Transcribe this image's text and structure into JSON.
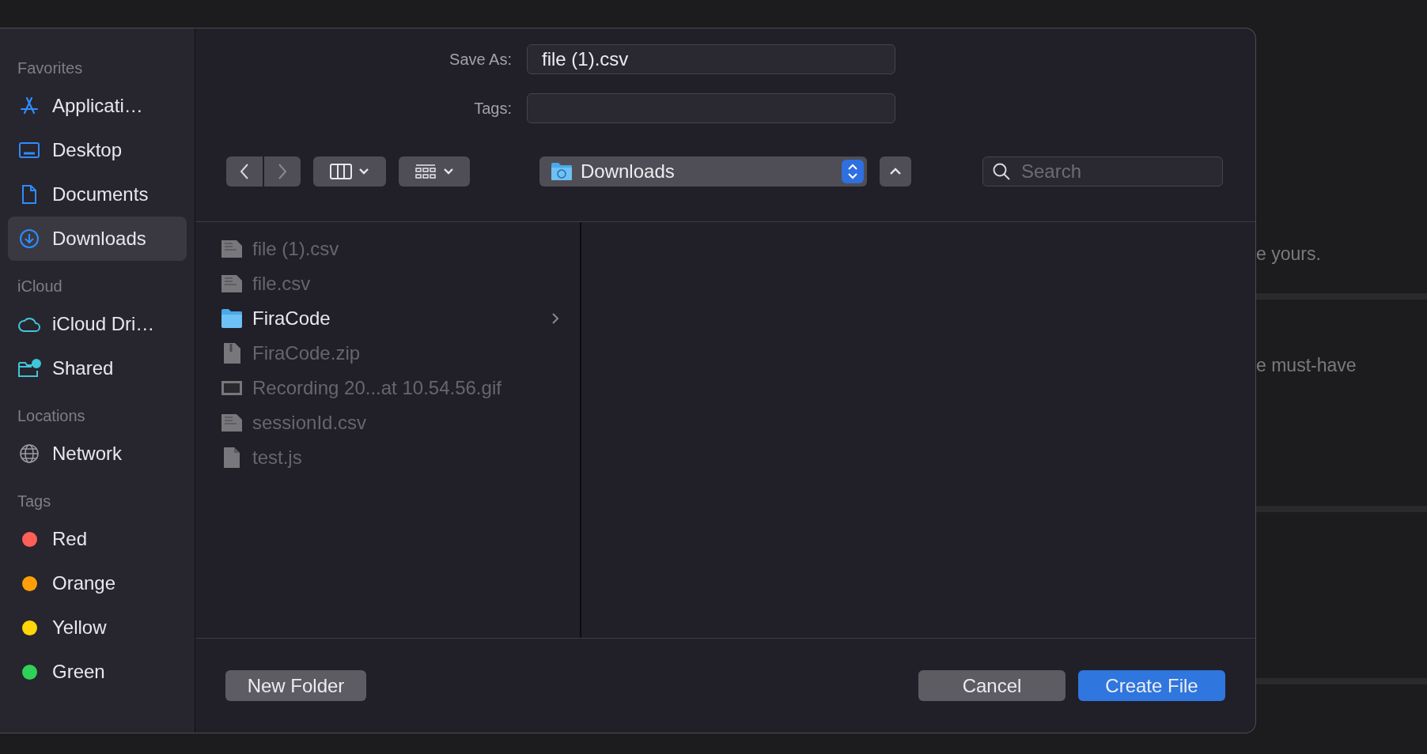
{
  "background": {
    "texts": [
      "e yours.",
      "e must-have"
    ]
  },
  "sidebar": {
    "sections": [
      {
        "header": "Favorites",
        "kind": "places",
        "items": [
          {
            "label": "Applicati…",
            "selected": false
          },
          {
            "label": "Desktop",
            "selected": false
          },
          {
            "label": "Documents",
            "selected": false
          },
          {
            "label": "Downloads",
            "selected": true
          }
        ]
      },
      {
        "header": "iCloud",
        "kind": "places",
        "items": [
          {
            "label": "iCloud Dri…",
            "selected": false
          },
          {
            "label": "Shared",
            "selected": false
          }
        ]
      },
      {
        "header": "Locations",
        "kind": "places",
        "items": [
          {
            "label": "Network",
            "selected": false
          }
        ]
      },
      {
        "header": "Tags",
        "kind": "tags",
        "items": [
          {
            "label": "Red",
            "color": "#fe5f57",
            "selected": false
          },
          {
            "label": "Orange",
            "color": "#fe9f0a",
            "selected": false
          },
          {
            "label": "Yellow",
            "color": "#ffd60a",
            "selected": false
          },
          {
            "label": "Green",
            "color": "#30d158",
            "selected": false
          }
        ]
      }
    ]
  },
  "save_as": {
    "label": "Save As:",
    "value": "file (1).csv"
  },
  "tags_field": {
    "label": "Tags:"
  },
  "toolbar": {
    "location": "Downloads",
    "search": {
      "placeholder": "Search"
    }
  },
  "files": [
    {
      "name": "file (1).csv",
      "kind": "csv",
      "disabled": true
    },
    {
      "name": "file.csv",
      "kind": "csv",
      "disabled": true
    },
    {
      "name": "FiraCode",
      "kind": "folder",
      "disabled": false
    },
    {
      "name": "FiraCode.zip",
      "kind": "zip",
      "disabled": true
    },
    {
      "name": "Recording 20...at 10.54.56.gif",
      "kind": "gif",
      "disabled": true
    },
    {
      "name": "sessionId.csv",
      "kind": "csv",
      "disabled": true
    },
    {
      "name": "test.js",
      "kind": "js",
      "disabled": true
    }
  ],
  "buttons": {
    "new_folder": "New Folder",
    "cancel": "Cancel",
    "confirm": "Create File"
  }
}
